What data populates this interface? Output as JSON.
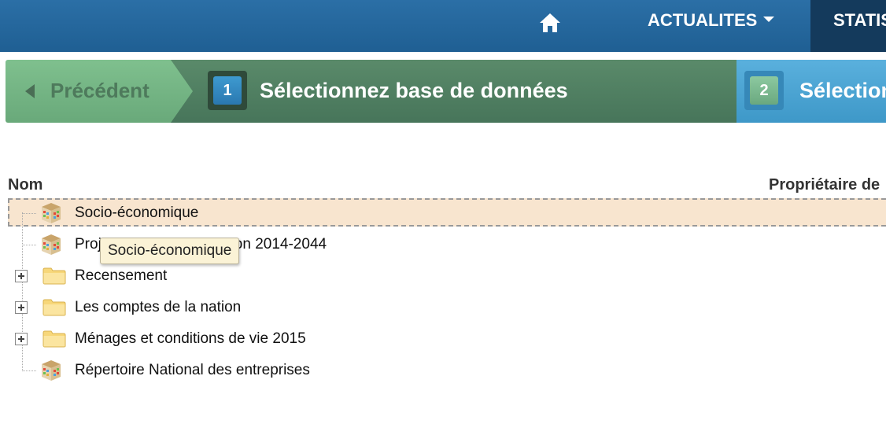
{
  "topnav": {
    "home_icon": "home-icon",
    "items": [
      {
        "label": "ACTUALITES",
        "has_dropdown": true
      },
      {
        "label": "STATIS"
      }
    ]
  },
  "wizard": {
    "previous_label": "Précédent",
    "steps": [
      {
        "number": "1",
        "label": "Sélectionnez base de données",
        "active": true
      },
      {
        "number": "2",
        "label": "Sélection",
        "active": false
      }
    ]
  },
  "table": {
    "columns": [
      "Nom",
      "Propriétaire de"
    ],
    "rows": [
      {
        "label": "Socio-économique",
        "icon": "cube-icon",
        "selected": true,
        "expandable": false
      },
      {
        "label": "Projection de la population 2014-2044",
        "icon": "cube-icon",
        "selected": false,
        "expandable": false
      },
      {
        "label": "Recensement",
        "icon": "folder-icon",
        "selected": false,
        "expandable": true
      },
      {
        "label": "Les comptes de la nation",
        "icon": "folder-icon",
        "selected": false,
        "expandable": true
      },
      {
        "label": "Ménages et conditions de vie 2015",
        "icon": "folder-icon",
        "selected": false,
        "expandable": true
      },
      {
        "label": "Répertoire National des entreprises",
        "icon": "cube-icon",
        "selected": false,
        "expandable": false
      }
    ]
  },
  "tooltip": {
    "text": "Socio-économique"
  },
  "colors": {
    "nav_bg": "#2b6fa6",
    "nav_active_bg": "#143a5c",
    "prev_bg": "#7fc08e",
    "step_active_bg": "#5a8a6a",
    "step_next_bg": "#5ab0dd",
    "selection_bg": "#f8e5cf",
    "tooltip_bg": "#fbf3d6"
  }
}
